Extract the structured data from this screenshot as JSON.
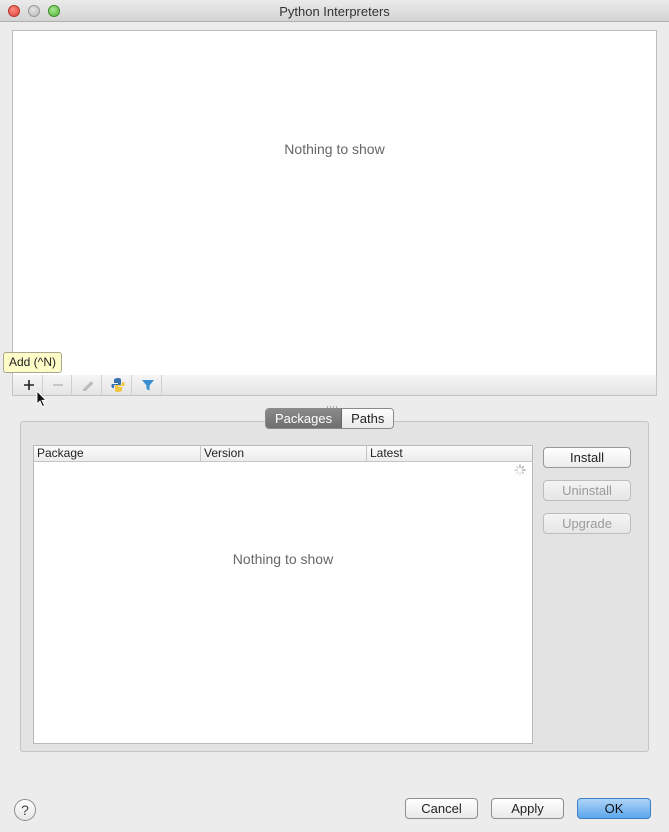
{
  "window": {
    "title": "Python Interpreters"
  },
  "interpreters": {
    "empty_text": "Nothing to show",
    "tooltip": "Add (^N)",
    "toolbar": {
      "add_icon": "plus-icon",
      "remove_icon": "minus-icon",
      "edit_icon": "pencil-icon",
      "python_icon": "python-icon",
      "filter_icon": "filter-icon"
    }
  },
  "tabs": [
    {
      "label": "Packages",
      "active": true
    },
    {
      "label": "Paths",
      "active": false
    }
  ],
  "packages": {
    "columns": [
      "Package",
      "Version",
      "Latest"
    ],
    "empty_text": "Nothing to show",
    "loading": true
  },
  "actions": {
    "install": "Install",
    "uninstall": "Uninstall",
    "upgrade": "Upgrade"
  },
  "footer": {
    "help": "?",
    "cancel": "Cancel",
    "apply": "Apply",
    "ok": "OK"
  },
  "colors": {
    "accent": "#5ba6ec",
    "tooltip_bg": "#fdfcc8",
    "filter_icon": "#3a8fd0"
  }
}
